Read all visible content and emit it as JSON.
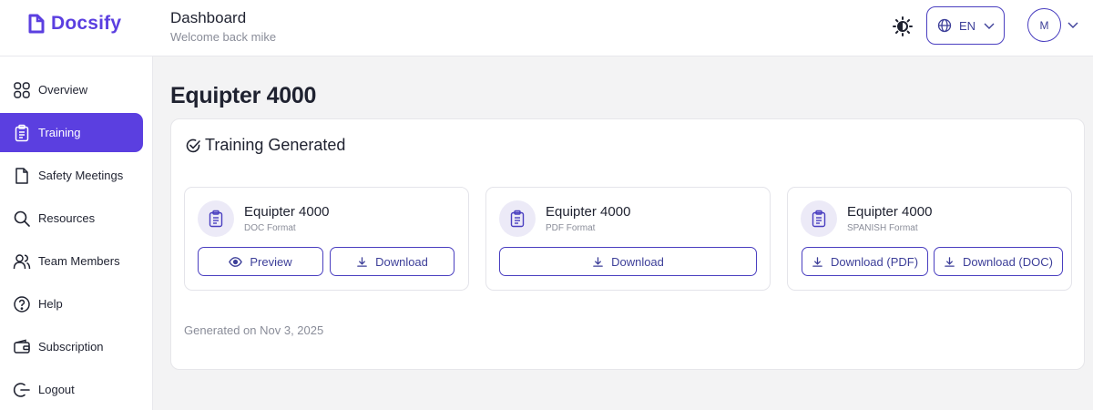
{
  "brand": {
    "name": "Docsify",
    "color": "#5b3fe0"
  },
  "header": {
    "title": "Dashboard",
    "subtitle": "Welcome back mike",
    "language": "EN",
    "avatar_initial": "M"
  },
  "sidebar": {
    "items": [
      {
        "label": "Overview",
        "icon": "grid-icon",
        "active": false
      },
      {
        "label": "Training",
        "icon": "clipboard-icon",
        "active": true
      },
      {
        "label": "Safety Meetings",
        "icon": "file-icon",
        "active": false
      },
      {
        "label": "Resources",
        "icon": "search-icon",
        "active": false
      },
      {
        "label": "Team Members",
        "icon": "users-icon",
        "active": false
      },
      {
        "label": "Help",
        "icon": "help-circle-icon",
        "active": false
      },
      {
        "label": "Subscription",
        "icon": "wallet-icon",
        "active": false
      },
      {
        "label": "Logout",
        "icon": "logout-icon",
        "active": false
      }
    ]
  },
  "main": {
    "page_title": "Equipter 4000",
    "panel_title": "Training Generated",
    "generated_on": "Generated on Nov 3, 2025",
    "cards": [
      {
        "name": "Equipter 4000",
        "format": "DOC Format",
        "buttons": [
          "Preview",
          "Download"
        ]
      },
      {
        "name": "Equipter 4000",
        "format": "PDF Format",
        "buttons": [
          "Download"
        ]
      },
      {
        "name": "Equipter 4000",
        "format": "SPANISH Format",
        "buttons": [
          "Download (PDF)",
          "Download (DOC)"
        ]
      }
    ]
  }
}
